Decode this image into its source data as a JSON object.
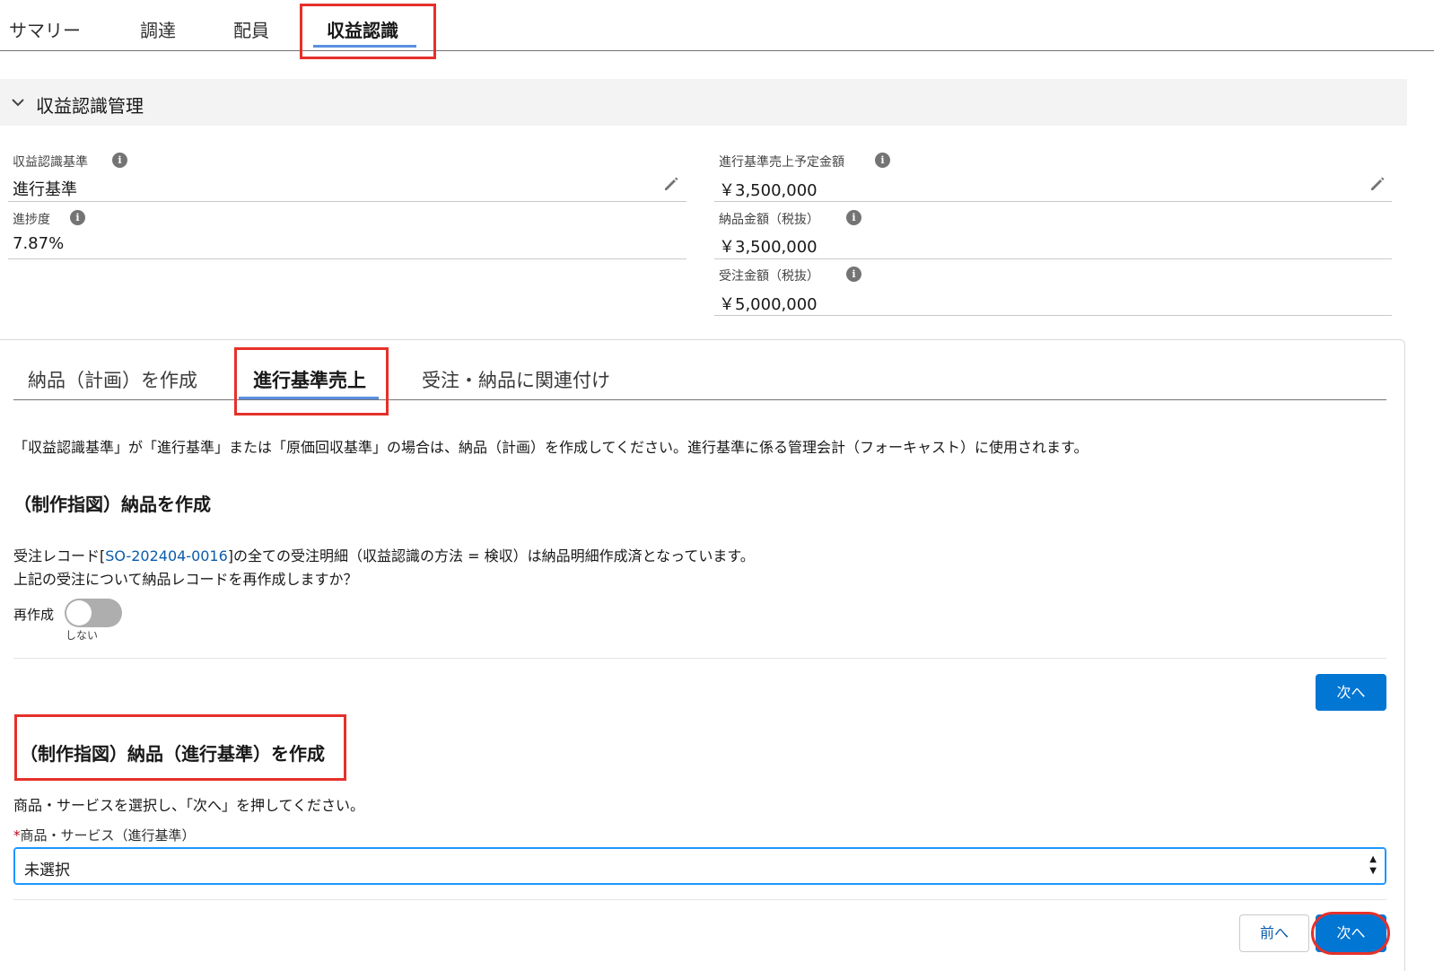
{
  "top_tabs": [
    "サマリー",
    "調達",
    "配員",
    "収益認識"
  ],
  "section": {
    "title": "収益認識管理"
  },
  "fields": {
    "basis_label": "収益認識基準",
    "basis_value": "進行基準",
    "progress_label": "進捗度",
    "progress_value": "7.87%",
    "planned_sales_label": "進行基準売上予定金額",
    "planned_sales_value": "￥3,500,000",
    "delivery_amount_label": "納品金額（税抜）",
    "delivery_amount_value": "￥3,500,000",
    "order_amount_label": "受注金額（税抜）",
    "order_amount_value": "￥5,000,000"
  },
  "sub_tabs": [
    "納品（計画）を作成",
    "進行基準売上",
    "受注・納品に関連付け"
  ],
  "note": "「収益認識基準」が「進行基準」または「原価回収基準」の場合は、納品（計画）を作成してください。進行基準に係る管理会計（フォーキャスト）に使用されます。",
  "step1": {
    "title": "（制作指図）納品を作成",
    "line1_prefix": "受注レコード[",
    "line1_link": "SO-202404-0016",
    "line1_suffix": "]の全ての受注明細（収益認識の方法 = 検収）は納品明細作成済となっています。",
    "line2": "上記の受注について納品レコードを再作成しますか？",
    "toggle_label": "再作成",
    "toggle_state": "しない",
    "next_label": "次へ"
  },
  "step2": {
    "title": "（制作指図）納品（進行基準）を作成",
    "instruction": "商品・サービスを選択し、「次へ」を押してください。",
    "required_mark": "*",
    "select_label": "商品・サービス（進行基準）",
    "select_value": "未選択",
    "prev_label": "前へ",
    "next_label": "次へ"
  }
}
